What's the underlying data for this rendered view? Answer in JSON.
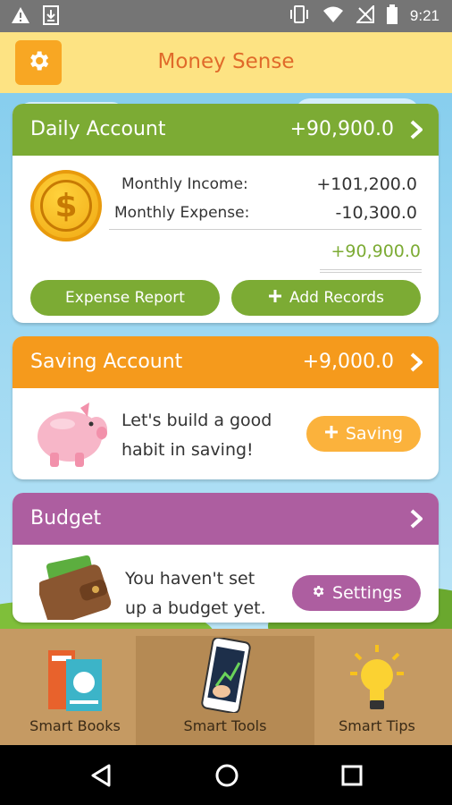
{
  "app": {
    "title": "Money Sense"
  },
  "status_bar": {
    "time": "9:21"
  },
  "daily_account": {
    "title": "Daily Account",
    "amount": "+90,900.0",
    "income_label": "Monthly Income:",
    "income_value": "+101,200.0",
    "expense_label": "Monthly Expense:",
    "expense_value": "-10,300.0",
    "total": "+90,900.0",
    "expense_report_label": "Expense Report",
    "add_records_label": "Add Records"
  },
  "saving_account": {
    "title": "Saving Account",
    "amount": "+9,000.0",
    "message_line1": "Let's build a good",
    "message_line2": "habit in saving!",
    "saving_button_label": "Saving"
  },
  "budget": {
    "title": "Budget",
    "message_line1": "You haven't set",
    "message_line2": "up a budget yet.",
    "settings_button_label": "Settings"
  },
  "bottom_tools": [
    {
      "label": "Smart Books"
    },
    {
      "label": "Smart Tools"
    },
    {
      "label": "Smart Tips"
    }
  ],
  "colors": {
    "daily_green": "#7cab34",
    "saving_orange": "#f59a1c",
    "budget_purple": "#ad5ea0",
    "header_yellow": "#fde383",
    "title_orange": "#e06a2a"
  }
}
